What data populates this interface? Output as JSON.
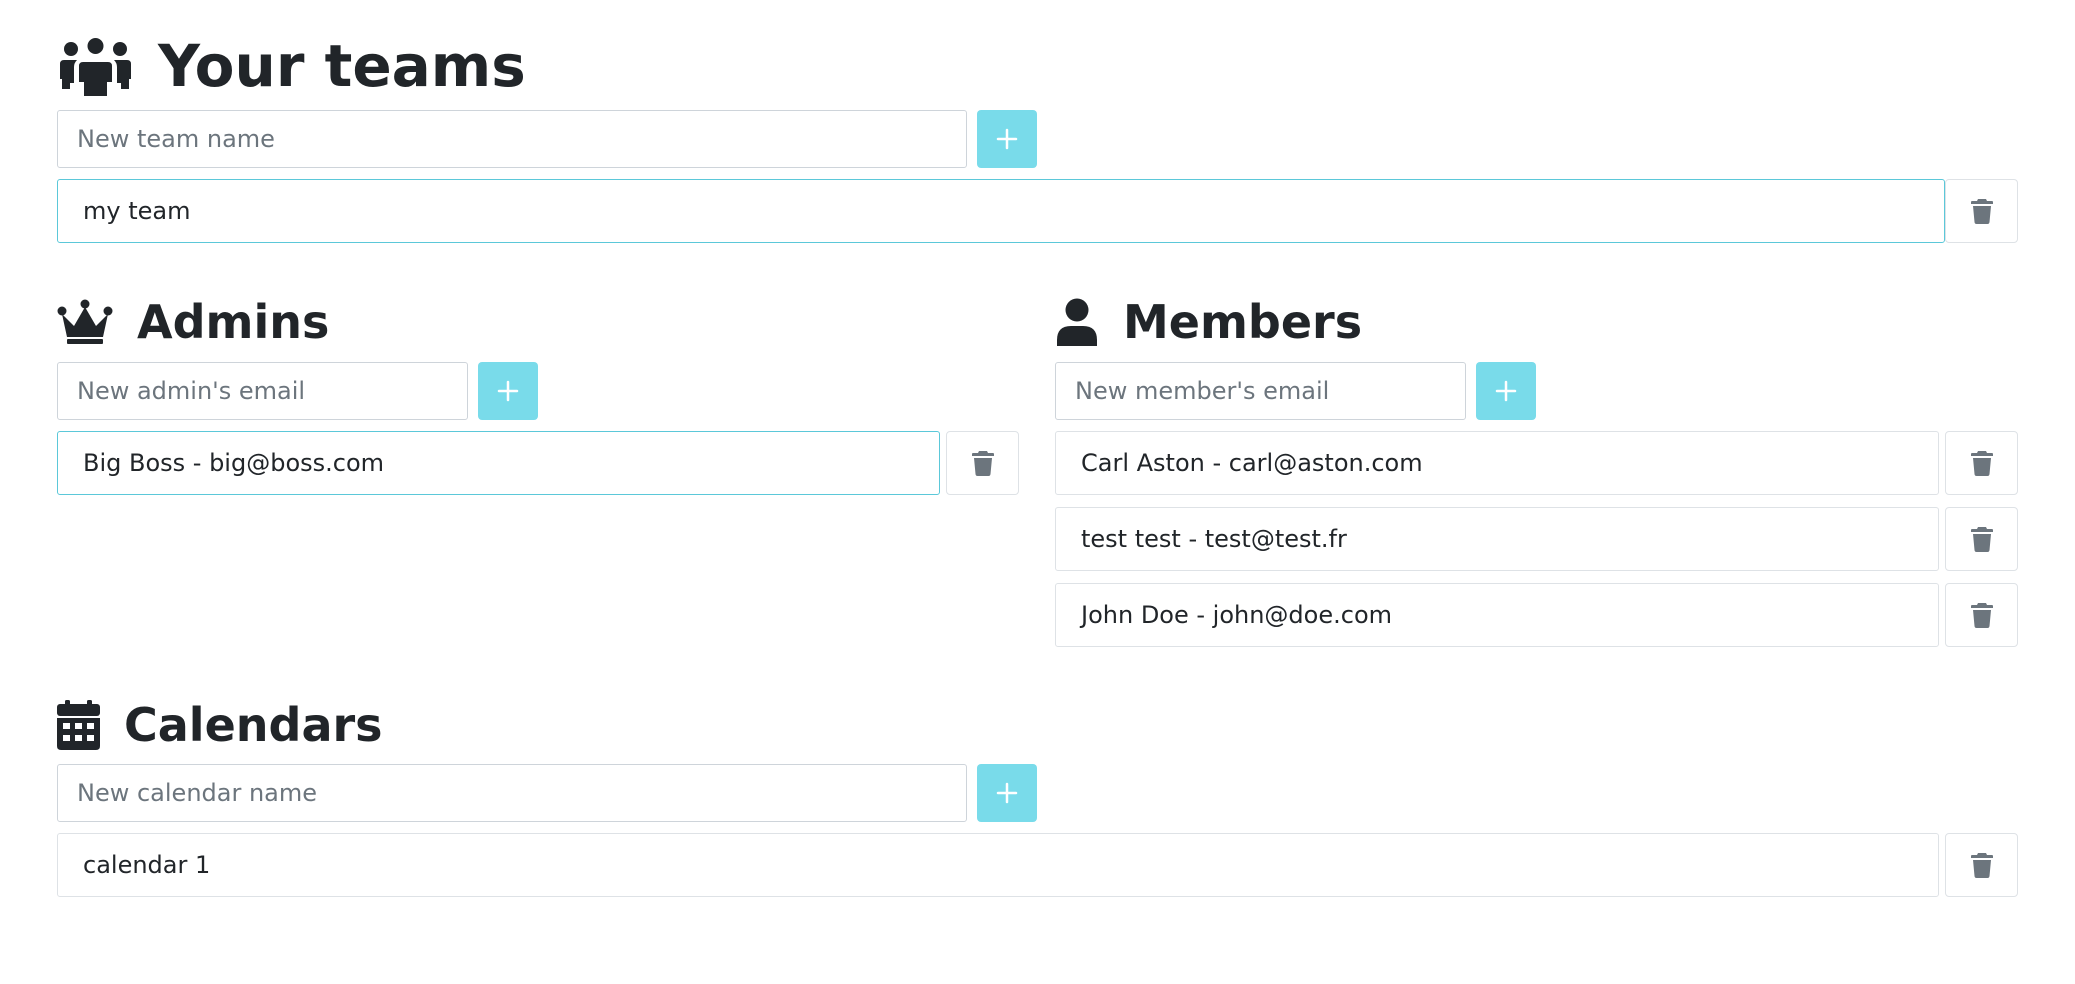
{
  "teams": {
    "title": "Your teams",
    "icon": "users-icon",
    "new_placeholder": "New team name",
    "items": [
      {
        "label": "my team",
        "selected": true
      }
    ]
  },
  "admins": {
    "title": "Admins",
    "icon": "crown-icon",
    "new_placeholder": "New admin's email",
    "items": [
      {
        "label": "Big Boss - big@boss.com",
        "selected": true
      }
    ]
  },
  "members": {
    "title": "Members",
    "icon": "user-icon",
    "new_placeholder": "New member's email",
    "items": [
      {
        "label": "Carl Aston - carl@aston.com"
      },
      {
        "label": "test test - test@test.fr"
      },
      {
        "label": "John Doe - john@doe.com"
      }
    ]
  },
  "calendars": {
    "title": "Calendars",
    "icon": "calendar-icon",
    "new_placeholder": "New calendar name",
    "items": [
      {
        "label": "calendar 1"
      }
    ]
  },
  "colors": {
    "accent": "#79dbea",
    "selected_border": "#5bc8d9",
    "text": "#212529",
    "icon_gray": "#6c757d"
  }
}
